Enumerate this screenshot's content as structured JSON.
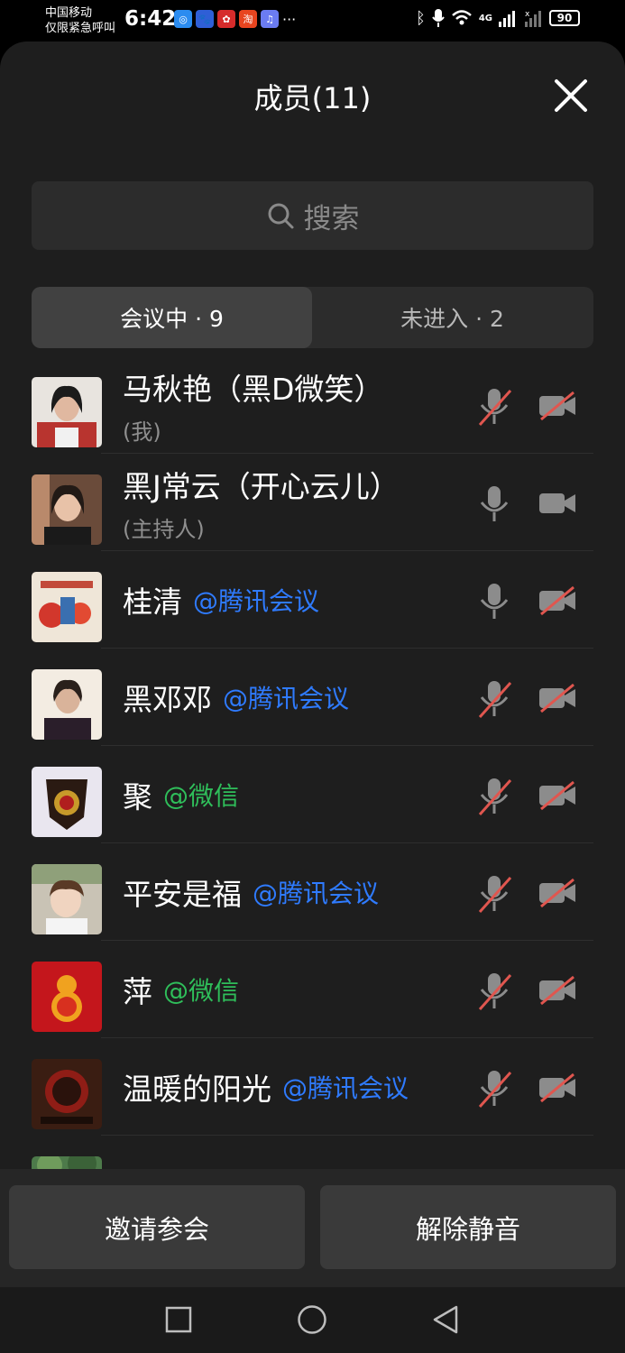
{
  "status_bar": {
    "carrier_line1": "中国移动",
    "carrier_line2": "仅限紧急呼叫",
    "time": "6:42",
    "more": "···",
    "network": "4G",
    "battery": "90",
    "app_icons": [
      "chat-app-icon",
      "baidu-app-icon",
      "red-app-icon",
      "taobao-app-icon",
      "music-app-icon"
    ]
  },
  "sheet": {
    "title": "成员(11)",
    "search_placeholder": "搜索",
    "tabs": [
      {
        "label": "会议中 · 9",
        "active": true
      },
      {
        "label": "未进入 · 2",
        "active": false
      }
    ]
  },
  "members": [
    {
      "name": "马秋艳（黑D微笑）",
      "role": "(我)",
      "tag": "",
      "tag_type": "",
      "mic_muted": true,
      "cam_off": true
    },
    {
      "name": "黑J常云（开心云儿）",
      "role": "(主持人)",
      "tag": "",
      "tag_type": "",
      "mic_muted": false,
      "cam_off": false
    },
    {
      "name": "桂清",
      "role": "",
      "tag": "@腾讯会议",
      "tag_type": "tencent",
      "mic_muted": false,
      "cam_off": true
    },
    {
      "name": "黑邓邓",
      "role": "",
      "tag": "@腾讯会议",
      "tag_type": "tencent",
      "mic_muted": true,
      "cam_off": true
    },
    {
      "name": "聚",
      "role": "",
      "tag": "@微信",
      "tag_type": "wechat",
      "mic_muted": true,
      "cam_off": true
    },
    {
      "name": "平安是福",
      "role": "",
      "tag": "@腾讯会议",
      "tag_type": "tencent",
      "mic_muted": true,
      "cam_off": true
    },
    {
      "name": "萍",
      "role": "",
      "tag": "@微信",
      "tag_type": "wechat",
      "mic_muted": true,
      "cam_off": true
    },
    {
      "name": "温暖的阳光",
      "role": "",
      "tag": "@腾讯会议",
      "tag_type": "tencent",
      "mic_muted": true,
      "cam_off": true
    }
  ],
  "footer": {
    "invite_label": "邀请参会",
    "unmute_label": "解除静音"
  },
  "colors": {
    "sheet_bg": "#1e1e1e",
    "tencent_tag": "#2f7bff",
    "wechat_tag": "#2fbe5a",
    "muted_slash": "#e0564f",
    "icon_gray": "#8c8c8c"
  }
}
